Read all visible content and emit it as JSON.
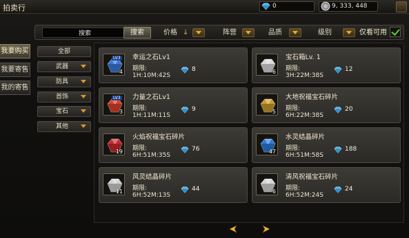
{
  "window": {
    "title": "拍卖行",
    "diamonds": "0",
    "silver": "9, 333, 448"
  },
  "side_tabs": [
    {
      "label": "我要购买",
      "active": true
    },
    {
      "label": "我要寄售",
      "active": false
    },
    {
      "label": "我的寄售",
      "active": false
    }
  ],
  "search": {
    "input_value": "搜索",
    "button_label": "搜索"
  },
  "filters": {
    "price": "价格",
    "price_sort": "↓",
    "camp": "阵营",
    "quality": "品质",
    "level": "级别",
    "only_usable": "仅看可用",
    "only_usable_checked": true
  },
  "categories": [
    {
      "label": "全部",
      "has_arrow": false
    },
    {
      "label": "武器",
      "has_arrow": true
    },
    {
      "label": "防具",
      "has_arrow": true
    },
    {
      "label": "首饰",
      "has_arrow": true
    },
    {
      "label": "宝石",
      "has_arrow": true
    },
    {
      "label": "其他",
      "has_arrow": true
    }
  ],
  "listings": [
    {
      "name": "幸运之石Lv1",
      "count": "4",
      "deadline_label": "期限:",
      "deadline": "1H:10M:42S",
      "price": "8",
      "icon": "lucky-stone-icon",
      "badge": "LV3",
      "color": "#3a78d8"
    },
    {
      "name": "宝石箱Lv. 1",
      "count": "6",
      "deadline_label": "期限:",
      "deadline": "3H:22M:38S",
      "price": "12",
      "icon": "gem-box-icon",
      "badge": "",
      "color": "#d8d8d8"
    },
    {
      "name": "力量之石Lv1",
      "count": "3",
      "deadline_label": "期限:",
      "deadline": "1H:11M:11S",
      "price": "9",
      "icon": "power-stone-icon",
      "badge": "LV3",
      "color": "#d8402a"
    },
    {
      "name": "大地祝福宝石碎片",
      "count": "5",
      "deadline_label": "期限:",
      "deadline": "6H:22M:38S",
      "price": "20",
      "icon": "earth-gem-shard-icon",
      "badge": "",
      "color": "#c89a2a"
    },
    {
      "name": "火焰祝福宝石碎片",
      "count": "19",
      "deadline_label": "期限:",
      "deadline": "6H:51M:35S",
      "price": "76",
      "icon": "fire-gem-shard-icon",
      "badge": "",
      "color": "#c8282a"
    },
    {
      "name": "水灵结晶碎片",
      "count": "47",
      "deadline_label": "期限:",
      "deadline": "6H:51M:58S",
      "price": "188",
      "icon": "water-crystal-shard-icon",
      "badge": "",
      "color": "#2a7ad8"
    },
    {
      "name": "风灵结晶碎片",
      "count": "11",
      "deadline_label": "期限:",
      "deadline": "6H:52M:13S",
      "price": "44",
      "icon": "wind-crystal-shard-icon",
      "badge": "",
      "color": "#cfcfcf"
    },
    {
      "name": "清风祝福宝石碎片",
      "count": "6",
      "deadline_label": "期限:",
      "deadline": "6H:52M:24S",
      "price": "24",
      "icon": "breeze-gem-shard-icon",
      "badge": "",
      "color": "#d4d4d4"
    }
  ],
  "colors": {
    "accent_gold": "#e8a93a",
    "check_green": "#5fd12c",
    "diamond_blue": "#4fb8f0"
  },
  "pager": {
    "prev_icon": "arrow-left-icon",
    "next_icon": "arrow-right-icon"
  }
}
